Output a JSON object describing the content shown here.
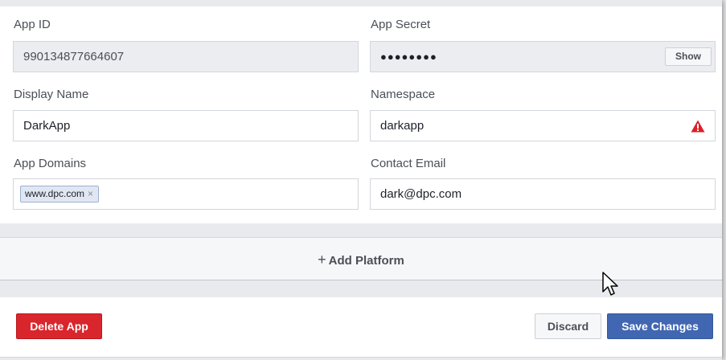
{
  "form": {
    "app_id": {
      "label": "App ID",
      "value": "990134877664607"
    },
    "app_secret": {
      "label": "App Secret",
      "value": "●●●●●●●●",
      "show_label": "Show"
    },
    "display_name": {
      "label": "Display Name",
      "value": "DarkApp"
    },
    "namespace": {
      "label": "Namespace",
      "value": "darkapp",
      "status_icon": "warning-triangle-icon"
    },
    "app_domains": {
      "label": "App Domains",
      "tags": [
        "www.dpc.com"
      ],
      "remove_glyph": "×"
    },
    "contact_email": {
      "label": "Contact Email",
      "value": "dark@dpc.com"
    }
  },
  "platform": {
    "plus": "+",
    "add_label": "Add Platform"
  },
  "actions": {
    "delete_label": "Delete App",
    "discard_label": "Discard",
    "save_label": "Save Changes"
  },
  "colors": {
    "danger": "#d9262c",
    "primary": "#4267b2",
    "warning": "#dd1f26"
  }
}
